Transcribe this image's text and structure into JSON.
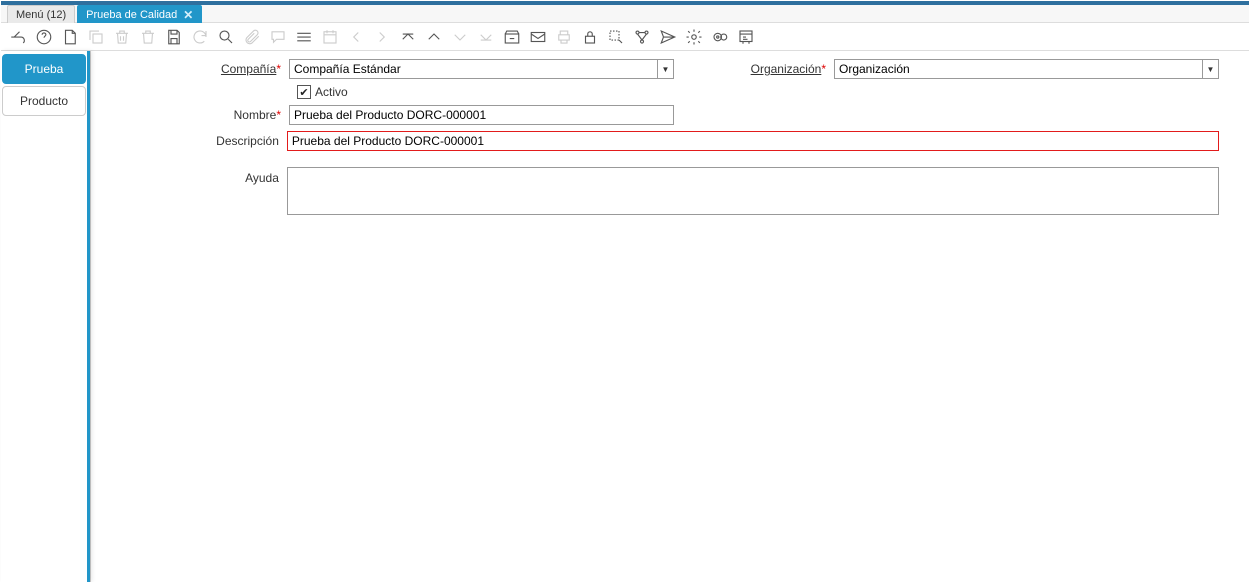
{
  "tabs": {
    "menu": "Menú (12)",
    "active": "Prueba de Calidad"
  },
  "toolbar_icons": [
    "back",
    "help",
    "new",
    "copy",
    "delete",
    "delete-all",
    "save",
    "refresh",
    "search",
    "attach",
    "chat",
    "grid",
    "date",
    "prev",
    "next",
    "expand-up",
    "up",
    "down",
    "expand-down",
    "archive",
    "mail",
    "print",
    "lock",
    "zoom",
    "workflow",
    "send",
    "settings",
    "process",
    "report"
  ],
  "sidebar": {
    "items": [
      "Prueba",
      "Producto"
    ]
  },
  "form": {
    "compania_label": "Compañía",
    "compania_value": "Compañía Estándar",
    "organizacion_label": "Organización",
    "organizacion_value": "Organización",
    "activo_label": "Activo",
    "activo_checked": true,
    "nombre_label": "Nombre",
    "nombre_value": "Prueba del Producto DORC-000001",
    "descripcion_label": "Descripción",
    "descripcion_value": "Prueba del Producto DORC-000001",
    "ayuda_label": "Ayuda",
    "ayuda_value": ""
  }
}
